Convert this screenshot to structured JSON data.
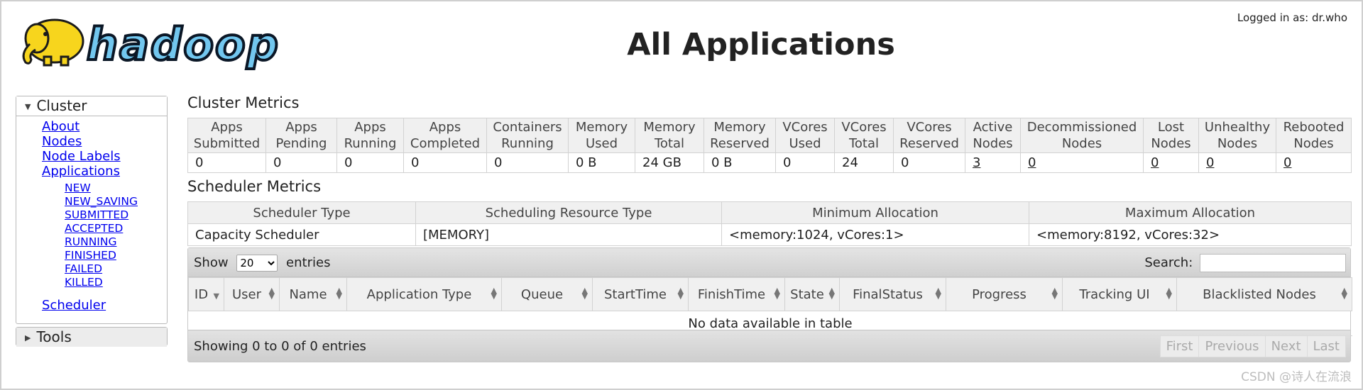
{
  "header": {
    "logo_text": "hadoop",
    "title": "All Applications",
    "login": "Logged in as: dr.who"
  },
  "sidebar": {
    "cluster_label": "Cluster",
    "links": [
      "About",
      "Nodes",
      "Node Labels",
      "Applications"
    ],
    "app_states": [
      "NEW",
      "NEW_SAVING",
      "SUBMITTED",
      "ACCEPTED",
      "RUNNING",
      "FINISHED",
      "FAILED",
      "KILLED"
    ],
    "scheduler": "Scheduler",
    "tools_label": "Tools"
  },
  "cluster_metrics": {
    "title": "Cluster Metrics",
    "headers": [
      "Apps Submitted",
      "Apps Pending",
      "Apps Running",
      "Apps Completed",
      "Containers Running",
      "Memory Used",
      "Memory Total",
      "Memory Reserved",
      "VCores Used",
      "VCores Total",
      "VCores Reserved",
      "Active Nodes",
      "Decommissioned Nodes",
      "Lost Nodes",
      "Unhealthy Nodes",
      "Rebooted Nodes"
    ],
    "values": [
      "0",
      "0",
      "0",
      "0",
      "0",
      "0 B",
      "24 GB",
      "0 B",
      "0",
      "24",
      "0",
      "3",
      "0",
      "0",
      "0",
      "0"
    ]
  },
  "scheduler_metrics": {
    "title": "Scheduler Metrics",
    "headers": [
      "Scheduler Type",
      "Scheduling Resource Type",
      "Minimum Allocation",
      "Maximum Allocation"
    ],
    "values": [
      "Capacity Scheduler",
      "[MEMORY]",
      "<memory:1024, vCores:1>",
      "<memory:8192, vCores:32>"
    ]
  },
  "apps_table": {
    "show_label": "Show",
    "entries_label": "entries",
    "page_size": "20",
    "search_label": "Search:",
    "search_value": "",
    "columns": [
      "ID",
      "User",
      "Name",
      "Application Type",
      "Queue",
      "StartTime",
      "FinishTime",
      "State",
      "FinalStatus",
      "Progress",
      "Tracking UI",
      "Blacklisted Nodes"
    ],
    "empty_message": "No data available in table",
    "info": "Showing 0 to 0 of 0 entries",
    "pager": [
      "First",
      "Previous",
      "Next",
      "Last"
    ]
  },
  "watermark": "CSDN @诗人在流浪",
  "colors": {
    "logo_blue": "#72c7ef",
    "logo_yellow": "#f7d51d",
    "header_bg": "#f0f0f0"
  }
}
